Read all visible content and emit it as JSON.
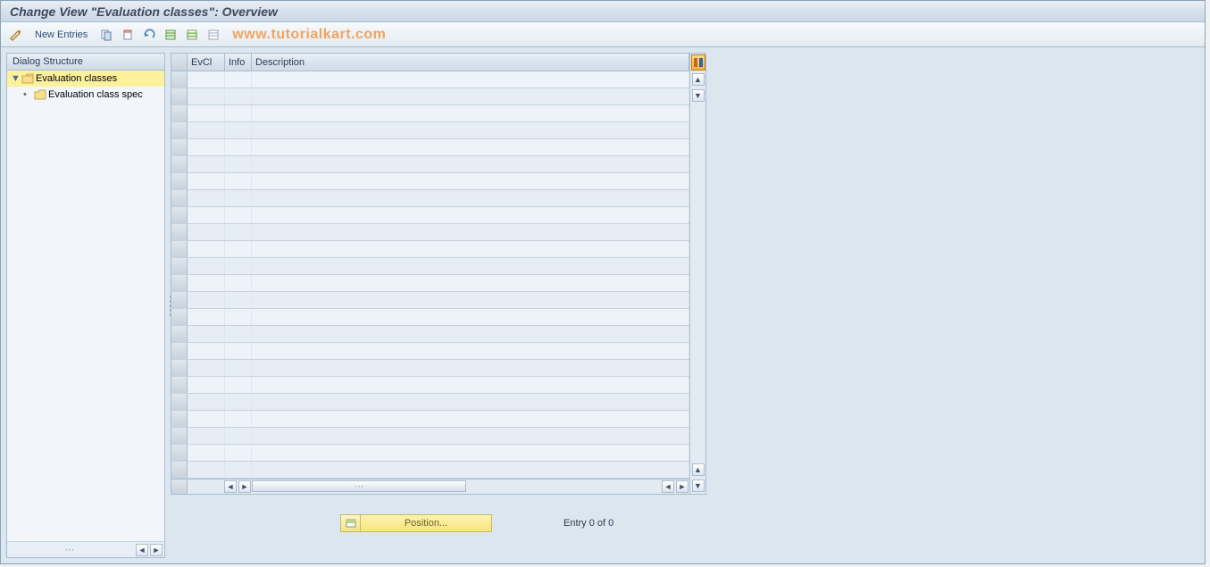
{
  "title": "Change View \"Evaluation classes\": Overview",
  "toolbar": {
    "new_entries": "New Entries",
    "watermark": "www.tutorialkart.com"
  },
  "sidebar": {
    "header": "Dialog Structure",
    "items": [
      {
        "label": "Evaluation classes",
        "selected": true
      },
      {
        "label": "Evaluation class spec",
        "selected": false
      }
    ]
  },
  "table": {
    "columns": {
      "evcl": "EvCl",
      "info": "Info",
      "desc": "Description"
    },
    "row_count": 24
  },
  "footer": {
    "position_label": "Position...",
    "entry_text": "Entry 0 of 0"
  }
}
